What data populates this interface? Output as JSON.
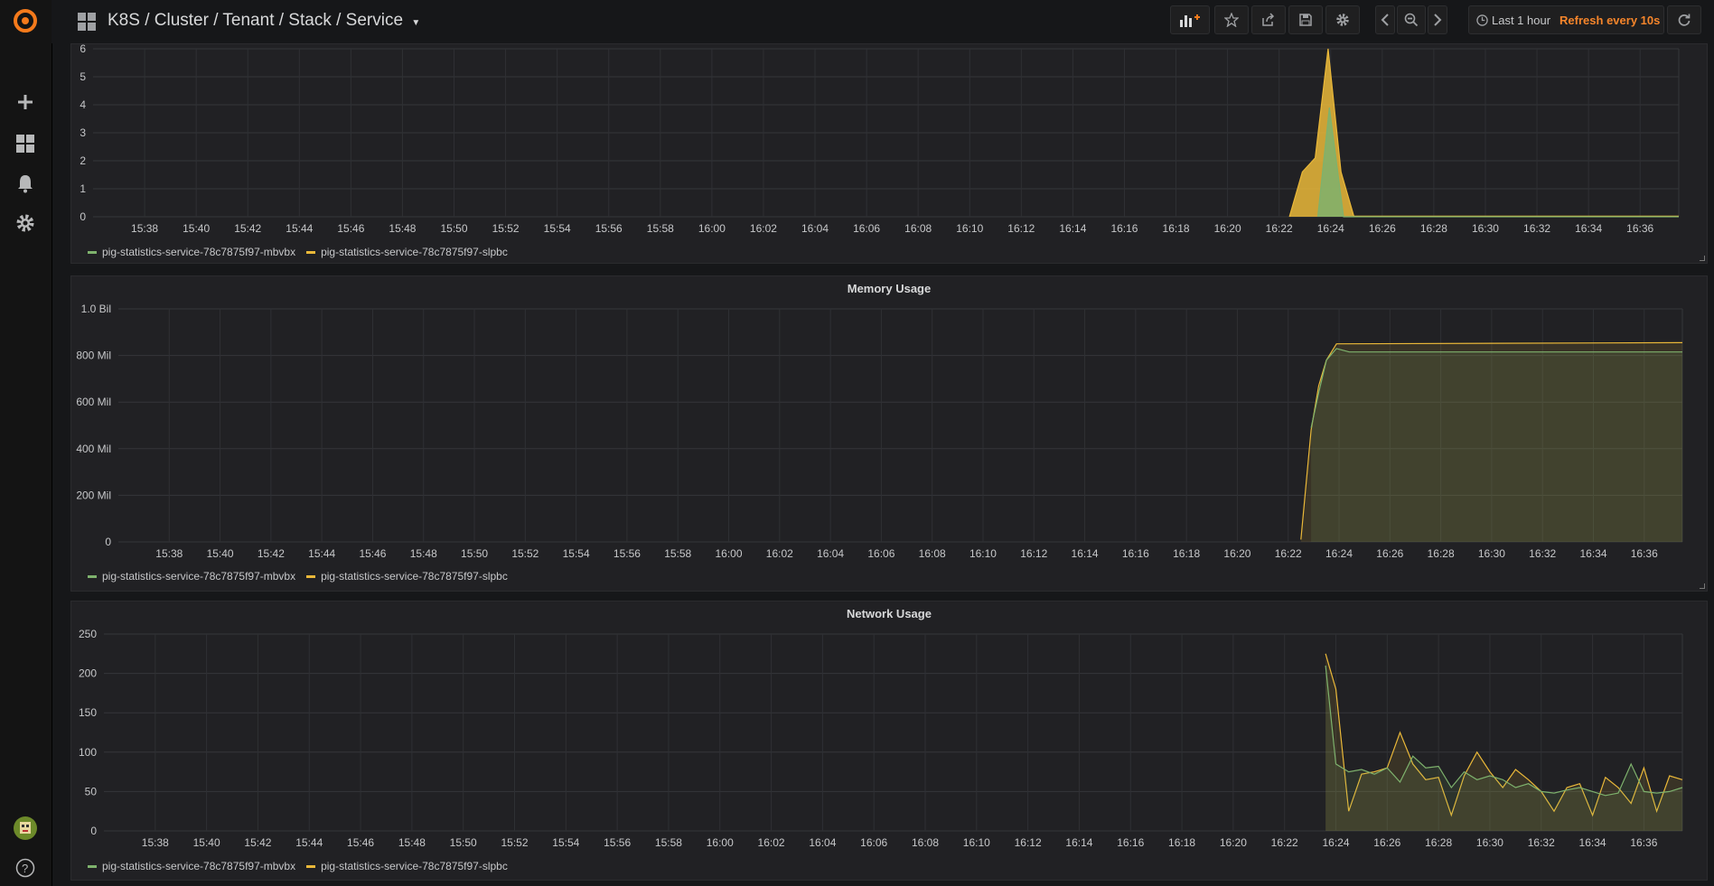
{
  "header": {
    "title": "K8S / Cluster / Tenant / Stack / Service",
    "time_range": "Last 1 hour",
    "refresh": "Refresh every 10s"
  },
  "colors": {
    "green": "#7eb26d",
    "yellow": "#eab839",
    "refresh": "#f5852b",
    "logo": "#f57a1b"
  },
  "legend": [
    {
      "name": "pig-statistics-service-78c7875f97-mbvbx",
      "color": "#7eb26d"
    },
    {
      "name": "pig-statistics-service-78c7875f97-slpbc",
      "color": "#eab839"
    }
  ],
  "x_ticks": [
    "15:38",
    "15:40",
    "15:42",
    "15:44",
    "15:46",
    "15:48",
    "15:50",
    "15:52",
    "15:54",
    "15:56",
    "15:58",
    "16:00",
    "16:02",
    "16:04",
    "16:06",
    "16:08",
    "16:10",
    "16:12",
    "16:14",
    "16:16",
    "16:18",
    "16:20",
    "16:22",
    "16:24",
    "16:26",
    "16:28",
    "16:30",
    "16:32",
    "16:34",
    "16:36"
  ],
  "panels": {
    "cpu": {
      "title": "",
      "y_ticks": [
        "0",
        "1",
        "2",
        "3",
        "4",
        "5",
        "6"
      ],
      "ylim": [
        0,
        6
      ]
    },
    "memory": {
      "title": "Memory Usage",
      "y_ticks": [
        "0",
        "200 Mil",
        "400 Mil",
        "600 Mil",
        "800 Mil",
        "1.0 Bil"
      ],
      "ylim": [
        0,
        1000
      ]
    },
    "network": {
      "title": "Network Usage",
      "y_ticks": [
        "0",
        "50",
        "100",
        "150",
        "200",
        "250"
      ],
      "ylim": [
        0,
        250
      ]
    }
  },
  "chart_data": [
    {
      "type": "area",
      "title": "",
      "ylim": [
        0,
        6
      ],
      "x_unit": "minutes after 15:36",
      "xlim": [
        0,
        61.5
      ],
      "series": [
        {
          "name": "pig-statistics-service-78c7875f97-slpbc",
          "x": [
            46.4,
            46.9,
            47.4,
            47.9,
            48.4,
            48.9,
            61.5
          ],
          "values": [
            0,
            1.6,
            2.1,
            6.0,
            1.6,
            0.02,
            0.02
          ]
        },
        {
          "name": "pig-statistics-service-78c7875f97-mbvbx",
          "x": [
            47.5,
            47.95,
            48.5,
            48.9,
            61.5
          ],
          "values": [
            0,
            3.9,
            0,
            0,
            0
          ]
        }
      ]
    },
    {
      "type": "area",
      "title": "Memory Usage",
      "ylim": [
        0,
        1000
      ],
      "x_unit": "minutes after 15:36",
      "xlim": [
        0,
        61.5
      ],
      "series": [
        {
          "name": "pig-statistics-service-78c7875f97-slpbc",
          "x": [
            46.5,
            46.9,
            47.2,
            47.5,
            47.9,
            61.5
          ],
          "values": [
            10,
            480,
            670,
            780,
            850,
            855
          ]
        },
        {
          "name": "pig-statistics-service-78c7875f97-mbvbx",
          "x": [
            46.9,
            47.2,
            47.5,
            47.9,
            48.4,
            61.5
          ],
          "values": [
            490,
            640,
            780,
            830,
            815,
            815
          ]
        }
      ]
    },
    {
      "type": "area",
      "title": "Network Usage",
      "ylim": [
        0,
        250
      ],
      "x_unit": "minutes after 15:36",
      "xlim": [
        0,
        61.5
      ],
      "series": [
        {
          "name": "pig-statistics-service-78c7875f97-slpbc",
          "x": [
            47.6,
            48.0,
            48.5,
            49.0,
            49.5,
            50.0,
            50.5,
            51.0,
            51.5,
            52.0,
            52.5,
            53.0,
            53.5,
            54.0,
            54.5,
            55.0,
            55.5,
            56.0,
            56.5,
            57.0,
            57.5,
            58.0,
            58.5,
            59.0,
            59.5,
            60.0,
            60.5,
            61.0,
            61.5
          ],
          "values": [
            225,
            180,
            25,
            72,
            75,
            80,
            125,
            85,
            65,
            68,
            20,
            70,
            100,
            75,
            55,
            78,
            65,
            50,
            25,
            55,
            60,
            20,
            68,
            55,
            35,
            80,
            25,
            70,
            65
          ]
        },
        {
          "name": "pig-statistics-service-78c7875f97-mbvbx",
          "x": [
            47.6,
            48.0,
            48.5,
            49.0,
            49.5,
            50.0,
            50.5,
            51.0,
            51.5,
            52.0,
            52.5,
            53.0,
            53.5,
            54.0,
            54.5,
            55.0,
            55.5,
            56.0,
            56.5,
            57.0,
            57.5,
            58.0,
            58.5,
            59.0,
            59.5,
            60.0,
            60.5,
            61.0,
            61.5
          ],
          "values": [
            210,
            85,
            75,
            78,
            72,
            80,
            62,
            95,
            80,
            82,
            55,
            75,
            65,
            70,
            65,
            55,
            60,
            50,
            48,
            52,
            55,
            50,
            45,
            48,
            85,
            50,
            48,
            50,
            55
          ]
        }
      ]
    }
  ]
}
